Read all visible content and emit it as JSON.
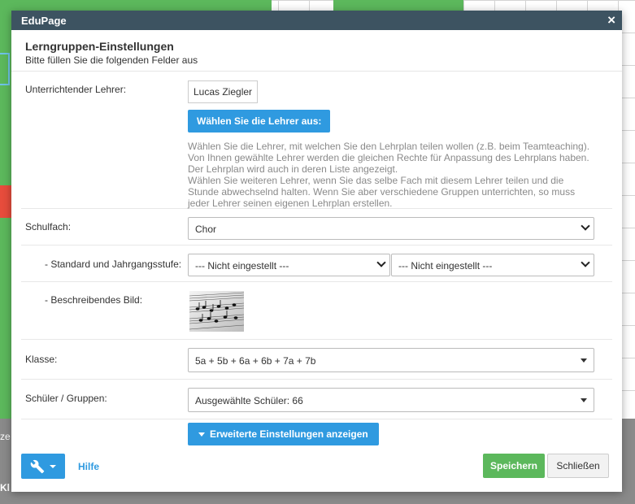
{
  "background": {
    "bottom_left_text_1": "ze",
    "bottom_left_text_2": "Kl"
  },
  "dialog": {
    "window_title": "EduPage",
    "close_symbol": "×",
    "heading": "Lerngruppen-Einstellungen",
    "subheading": "Bitte füllen Sie die folgenden Felder aus",
    "teacher": {
      "label": "Unterrichtender Lehrer:",
      "value": "Lucas Ziegler",
      "choose_button": "Wählen Sie die Lehrer aus:",
      "help_lines": [
        "Wählen Sie die Lehrer, mit welchen Sie den Lehrplan teilen wollen (z.B. beim Teamteaching).",
        "Von Ihnen gewählte Lehrer werden die gleichen Rechte für Anpassung des Lehrplans haben.",
        "Der Lehrplan wird auch in deren Liste angezeigt.",
        "Wählen Sie weiteren Lehrer, wenn Sie das selbe Fach mit diesem Lehrer teilen und die",
        "Stunde abwechselnd halten. Wenn Sie aber verschiedene Gruppen unterrichten, so muss",
        "jeder Lehrer seinen eigenen Lehrplan erstellen."
      ]
    },
    "subject": {
      "label": "Schulfach:",
      "value": "Chor"
    },
    "standard": {
      "label": "- Standard und Jahrgangsstufe:",
      "value_1": "--- Nicht eingestellt ---",
      "value_2": "--- Nicht eingestellt ---"
    },
    "image": {
      "label": "- Beschreibendes Bild:"
    },
    "classes": {
      "label": "Klasse:",
      "value": "5a + 5b + 6a + 6b + 7a + 7b"
    },
    "students": {
      "label": "Schüler / Gruppen:",
      "value": "Ausgewählte Schüler: 66"
    },
    "advanced_button": "Erweiterte Einstellungen anzeigen",
    "footer": {
      "help_link": "Hilfe",
      "save_button": "Speichern",
      "close_button": "Schließen"
    }
  },
  "colors": {
    "titlebar": "#3d5361",
    "primary_blue": "#2f9ae0",
    "save_green": "#5cb85c"
  }
}
